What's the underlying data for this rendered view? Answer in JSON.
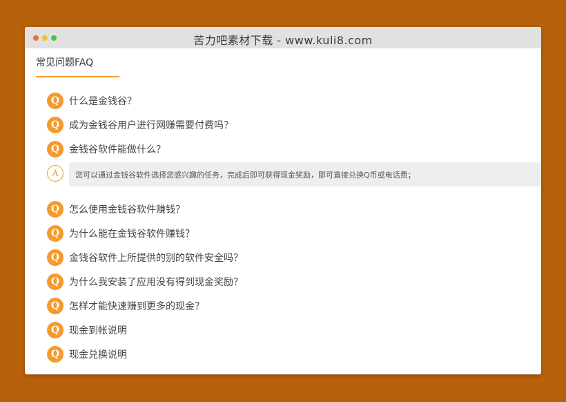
{
  "window": {
    "title": "苦力吧素材下载 - www.kuli8.com"
  },
  "section": {
    "title": "常见问题FAQ"
  },
  "faq": {
    "q_badge": "Q",
    "a_badge": "A",
    "items_before": [
      {
        "question": "什么是金钱谷？"
      },
      {
        "question": "成为金钱谷用户进行网赚需要付费吗？"
      },
      {
        "question": "金钱谷软件能做什么？"
      }
    ],
    "answer": "您可以通过金钱谷软件选择您感兴趣的任务，完成后即可获得现金奖励，即可直接兑换Q币或电话费；",
    "items_after": [
      {
        "question": "怎么使用金钱谷软件赚钱？"
      },
      {
        "question": "为什么能在金钱谷软件赚钱？"
      },
      {
        "question": "金钱谷软件上所提供的别的软件安全吗？"
      },
      {
        "question": "为什么我安装了应用没有得到现金奖励？"
      },
      {
        "question": "怎样才能快速赚到更多的现金？"
      },
      {
        "question": "现金到帐说明"
      },
      {
        "question": "现金兑换说明"
      }
    ]
  },
  "colors": {
    "background": "#b8610d",
    "accent": "#f59a2f",
    "titlebar": "#e1e1e1"
  }
}
